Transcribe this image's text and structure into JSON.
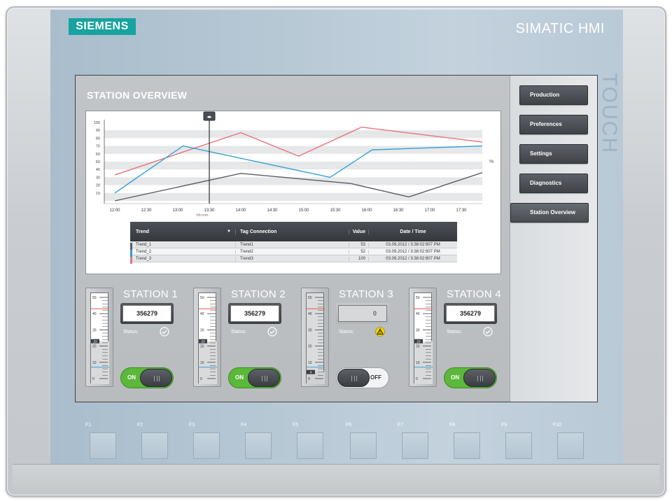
{
  "device": {
    "brand": "SIEMENS",
    "product": "SIMATIC HMI",
    "side_label": "TOUCH"
  },
  "screen": {
    "title": "STATION OVERVIEW"
  },
  "nav": {
    "items": [
      {
        "label": "Production"
      },
      {
        "label": "Preferences"
      },
      {
        "label": "Settings"
      },
      {
        "label": "Diagnostics"
      },
      {
        "label": "Station Overview",
        "active": true
      }
    ]
  },
  "chart_data": {
    "type": "line",
    "x": [
      "12:00",
      "12:30",
      "13:00",
      "13:30",
      "14:00",
      "14:30",
      "15:00",
      "15:30",
      "16:00",
      "16:30",
      "17:00",
      "17:30"
    ],
    "xlabel": "hh:mm",
    "ylabel": "%",
    "ylim": [
      0,
      100
    ],
    "yticks": [
      10,
      20,
      30,
      40,
      50,
      60,
      70,
      80,
      90,
      100
    ],
    "grid": true,
    "cursor_x": "13:30",
    "cursor_icon": "left-right-arrows-icon",
    "series": [
      {
        "color": "#e8737a",
        "points": [
          [
            "12:00",
            33
          ],
          [
            "14:00",
            87
          ],
          [
            "14:55",
            57
          ],
          [
            "15:55",
            94
          ],
          [
            "17:50",
            75
          ]
        ]
      },
      {
        "color": "#2f9fd2",
        "points": [
          [
            "12:00",
            10
          ],
          [
            "13:05",
            70
          ],
          [
            "15:25",
            30
          ],
          [
            "16:05",
            65
          ],
          [
            "17:50",
            70
          ]
        ]
      },
      {
        "color": "#5a5d63",
        "points": [
          [
            "12:00",
            0
          ],
          [
            "14:00",
            35
          ],
          [
            "15:45",
            22
          ],
          [
            "16:40",
            5
          ],
          [
            "17:50",
            36
          ]
        ]
      }
    ]
  },
  "trend_table": {
    "headers": [
      "Trend",
      "Tag Connection",
      "Value",
      "Date / Time"
    ],
    "rows": [
      {
        "trend": "Trend_1",
        "tag": "Trend1",
        "value": "53",
        "datetime": "03.09.2012 / 3:38:02:907 PM",
        "color": "#5a5d63"
      },
      {
        "trend": "Trend_2",
        "tag": "Trend2",
        "value": "52",
        "datetime": "03.09.2012 / 3:38:02:907 PM",
        "color": "#2f9fd2"
      },
      {
        "trend": "Trend_3",
        "tag": "Trend3",
        "value": "100",
        "datetime": "03.09.2012 / 3:38:02:907 PM",
        "color": "#e8737a"
      }
    ]
  },
  "stations": [
    {
      "name": "STATION 1",
      "value": "356279",
      "status_label": "Status:",
      "status": "ok",
      "toggle": "ON",
      "on": true,
      "level": 23,
      "enabled": true
    },
    {
      "name": "STATION 2",
      "value": "356279",
      "status_label": "Status:",
      "status": "ok",
      "toggle": "ON",
      "on": true,
      "level": 23,
      "enabled": true
    },
    {
      "name": "STATION 3",
      "value": "0",
      "status_label": "Status:",
      "status": "warning",
      "toggle": "OFF",
      "on": false,
      "level": 4,
      "enabled": false
    },
    {
      "name": "STATION 4",
      "value": "356279",
      "status_label": "Status:",
      "status": "ok",
      "toggle": "ON",
      "on": true,
      "level": 23,
      "enabled": true
    }
  ],
  "scale": {
    "ticks": [
      "50",
      "40",
      "30",
      "20",
      "10",
      "0"
    ],
    "max": 50,
    "high_limit": 43,
    "low_limit": 7
  },
  "fkeys": [
    "F1",
    "F2",
    "F3",
    "F4",
    "F5",
    "F6",
    "F7",
    "F8",
    "F9",
    "F10"
  ],
  "colors": {
    "brand": "#17a3a0",
    "toggle_on": "#5bb83a",
    "warning": "#f2d300",
    "limit_high": "#e05a5a",
    "limit_low": "#3aa0d8"
  }
}
